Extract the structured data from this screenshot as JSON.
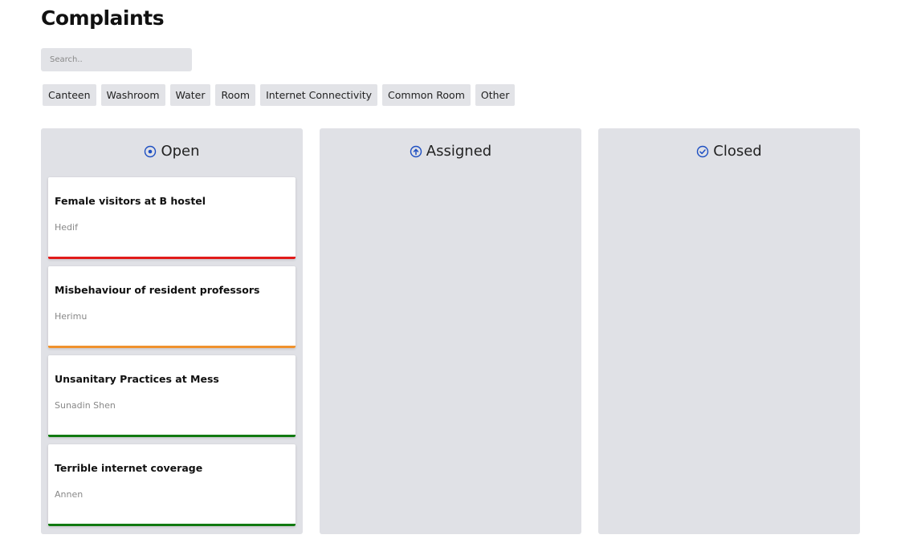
{
  "page": {
    "title": "Complaints"
  },
  "search": {
    "placeholder": "Search.."
  },
  "filters": [
    "Canteen",
    "Washroom",
    "Water",
    "Room",
    "Internet Connectivity",
    "Common Room",
    "Other"
  ],
  "columns": {
    "open": {
      "label": "Open",
      "icon": "target-circle-icon",
      "icon_color": "#1e4fc2"
    },
    "assigned": {
      "label": "Assigned",
      "icon": "arrow-up-circle-icon",
      "icon_color": "#1e4fc2"
    },
    "closed": {
      "label": "Closed",
      "icon": "check-circle-icon",
      "icon_color": "#1e4fc2"
    }
  },
  "cards": [
    {
      "title": "Female visitors at B hostel",
      "author": "Hedif",
      "priority_color": "#e11b1b"
    },
    {
      "title": "Misbehaviour of resident professors",
      "author": "Herimu",
      "priority_color": "#f0922d"
    },
    {
      "title": "Unsanitary Practices at Mess",
      "author": "Sunadin Shen",
      "priority_color": "#117a11"
    },
    {
      "title": "Terrible internet coverage",
      "author": "Annen",
      "priority_color": "#117a11"
    }
  ]
}
